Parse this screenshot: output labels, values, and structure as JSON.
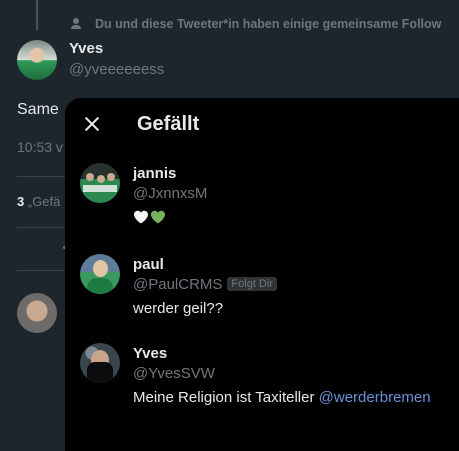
{
  "background": {
    "social_context": "Du und diese Tweeter*in haben einige gemeinsame Follow",
    "author_name": "Yves",
    "author_handle": "@yveeeeeess",
    "tweet_text": "Same",
    "time": "10:53 v",
    "likes_count": "3",
    "likes_label": "„Gefä"
  },
  "modal": {
    "title": "Gefällt",
    "users": [
      {
        "name": "jannis",
        "handle": "@JxnnxsM",
        "bio_hearts": [
          "white-heart-icon",
          "green-heart-icon"
        ]
      },
      {
        "name": "paul",
        "handle": "@PaulCRMS",
        "badge": "Folgt Dir",
        "bio": "werder geil??"
      },
      {
        "name": "Yves",
        "handle": "@YvesSVW",
        "bio": "Meine Religion ist Taxiteller",
        "bio_mention": "@werderbremen"
      }
    ]
  },
  "colors": {
    "background": "#1d252d",
    "modal": "#000000",
    "secondary_text": "#71767b",
    "mention": "#6b8fd4",
    "heart_green": "#78b159"
  }
}
